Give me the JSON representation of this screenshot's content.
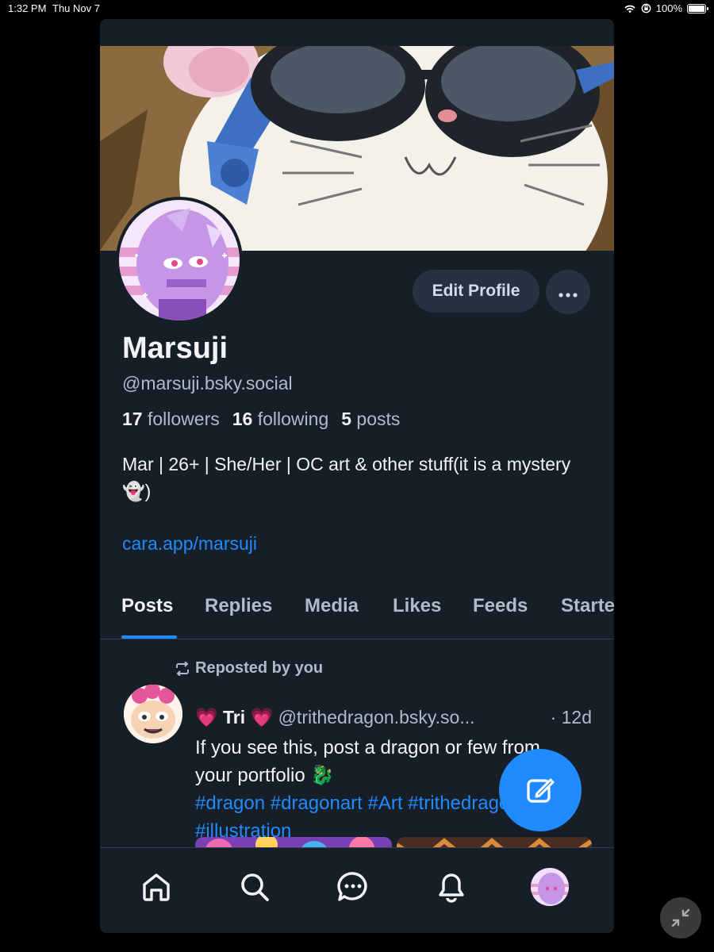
{
  "status_bar": {
    "time": "1:32 PM",
    "date": "Thu Nov 7",
    "battery": "100%",
    "battery_level": 1.0
  },
  "profile": {
    "display_name": "Marsuji",
    "handle": "@marsuji.bsky.social",
    "followers_count": "17",
    "followers_label": "followers",
    "following_count": "16",
    "following_label": "following",
    "posts_count": "5",
    "posts_label": "posts",
    "bio": "Mar | 26+ | She/Her | OC art & other stuff(it is a mystery👻)",
    "link": "cara.app/marsuji",
    "edit_button": "Edit Profile",
    "more_button": "•••"
  },
  "tabs": [
    {
      "label": "Posts",
      "active": true
    },
    {
      "label": "Replies",
      "active": false
    },
    {
      "label": "Media",
      "active": false
    },
    {
      "label": "Likes",
      "active": false
    },
    {
      "label": "Feeds",
      "active": false
    },
    {
      "label": "Starter",
      "active": false
    }
  ],
  "feed": {
    "reposted_label": "Reposted by you",
    "post": {
      "author": "💗 Tri 💗",
      "handle": "@trithedragon.bsky.so...",
      "time": "· 12d",
      "text": "If you see this, post a dragon or few from your portfolio 🐉",
      "tags": "#dragon #dragonart #Art #trithedragon #illustration"
    }
  },
  "colors": {
    "background": "#161e27",
    "accent": "#208bfe",
    "muted_text": "#aebbc9",
    "button_bg": "#243241"
  },
  "icons": {
    "nav": [
      "home-icon",
      "search-icon",
      "chat-icon",
      "bell-icon",
      "profile-avatar"
    ],
    "fab": "compose-icon",
    "repost": "repost-icon"
  }
}
